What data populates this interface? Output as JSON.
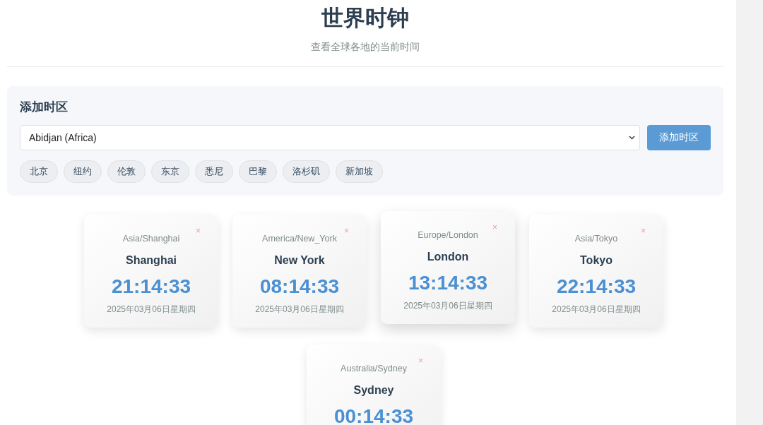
{
  "header": {
    "title": "世界时钟",
    "subtitle": "查看全球各地的当前时间"
  },
  "add_panel": {
    "title": "添加时区",
    "select": {
      "value": "Abidjan (Africa)"
    },
    "button": "添加时区",
    "quick_picks": [
      "北京",
      "纽约",
      "伦敦",
      "东京",
      "悉尼",
      "巴黎",
      "洛杉矶",
      "新加坡"
    ]
  },
  "clocks": [
    {
      "zone": "Asia/Shanghai",
      "city": "Shanghai",
      "time": "21:14:33",
      "date": "2025年03月06日星期四",
      "remove": "×",
      "hovered": false
    },
    {
      "zone": "America/New_York",
      "city": "New York",
      "time": "08:14:33",
      "date": "2025年03月06日星期四",
      "remove": "×",
      "hovered": false
    },
    {
      "zone": "Europe/London",
      "city": "London",
      "time": "13:14:33",
      "date": "2025年03月06日星期四",
      "remove": "×",
      "hovered": true
    },
    {
      "zone": "Asia/Tokyo",
      "city": "Tokyo",
      "time": "22:14:33",
      "date": "2025年03月06日星期四",
      "remove": "×",
      "hovered": false
    },
    {
      "zone": "Australia/Sydney",
      "city": "Sydney",
      "time": "00:14:33",
      "remove": "×",
      "hovered": false
    }
  ]
}
